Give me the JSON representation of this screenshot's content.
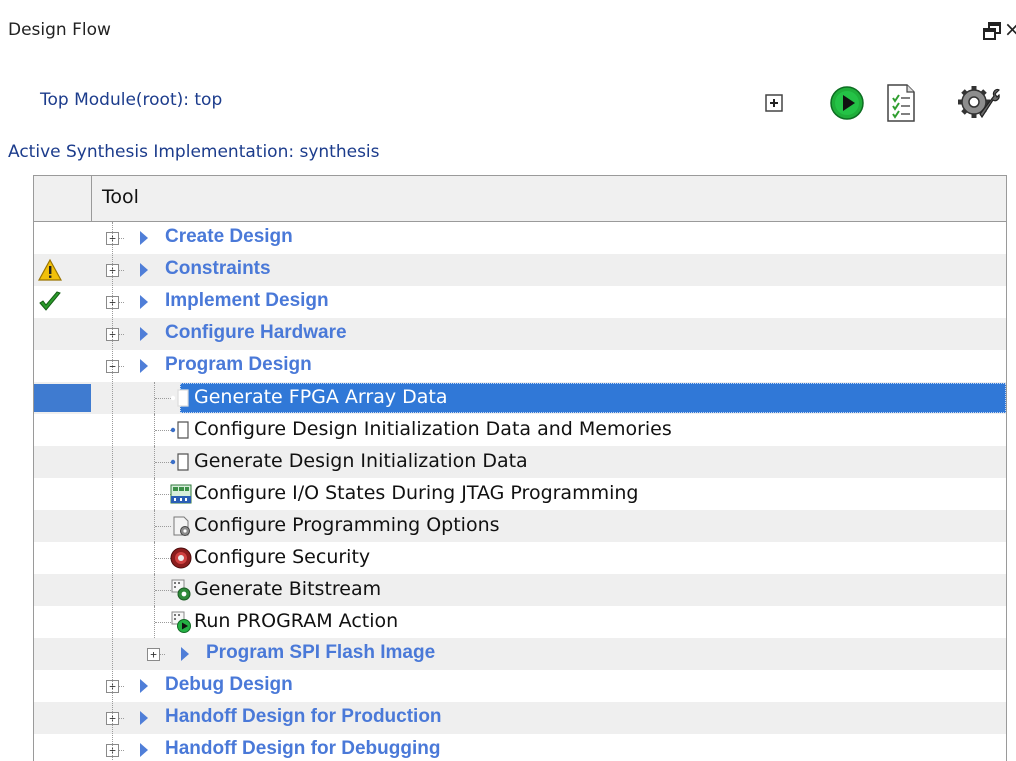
{
  "panel": {
    "title": "Design Flow",
    "float_icon": "float-window-icon",
    "close_glyph": "×"
  },
  "header_info": {
    "top_module": "Top Module(root): top",
    "active_synthesis": "Active Synthesis Implementation: synthesis"
  },
  "toolbar": [
    {
      "icon": "expand-all-icon"
    },
    {
      "icon": "run-icon"
    },
    {
      "icon": "report-icon"
    },
    {
      "icon": "options-wrench-icon"
    }
  ],
  "grid": {
    "column_header": "Tool",
    "rows": [
      {
        "kind": "category",
        "label": "Create Design",
        "status": "none",
        "expanded": false
      },
      {
        "kind": "category",
        "label": "Constraints",
        "status": "warning",
        "expanded": false
      },
      {
        "kind": "category",
        "label": "Implement Design",
        "status": "success",
        "expanded": false
      },
      {
        "kind": "category",
        "label": "Configure Hardware",
        "status": "none",
        "expanded": false
      },
      {
        "kind": "category",
        "label": "Program Design",
        "status": "none",
        "expanded": true
      },
      {
        "kind": "task",
        "label": "Generate FPGA Array Data",
        "icon": "document-icon",
        "selected": true
      },
      {
        "kind": "task",
        "label": "Configure Design Initialization Data and Memories",
        "icon": "document-icon"
      },
      {
        "kind": "task",
        "label": "Generate Design Initialization Data",
        "icon": "document-icon"
      },
      {
        "kind": "task",
        "label": "Configure I/O States During JTAG Programming",
        "icon": "io-states-icon"
      },
      {
        "kind": "task",
        "label": "Configure Programming Options",
        "icon": "programming-options-icon"
      },
      {
        "kind": "task",
        "label": "Configure Security",
        "icon": "security-icon"
      },
      {
        "kind": "task",
        "label": "Generate Bitstream",
        "icon": "bitstream-icon"
      },
      {
        "kind": "task",
        "label": "Run PROGRAM Action",
        "icon": "run-program-icon"
      },
      {
        "kind": "subcategory",
        "label": "Program SPI Flash Image",
        "expanded": false
      },
      {
        "kind": "category",
        "label": "Debug Design",
        "status": "none",
        "expanded": false
      },
      {
        "kind": "category",
        "label": "Handoff Design for Production",
        "status": "none",
        "expanded": false
      },
      {
        "kind": "category",
        "label": "Handoff Design for Debugging",
        "status": "none",
        "expanded": false
      }
    ]
  }
}
